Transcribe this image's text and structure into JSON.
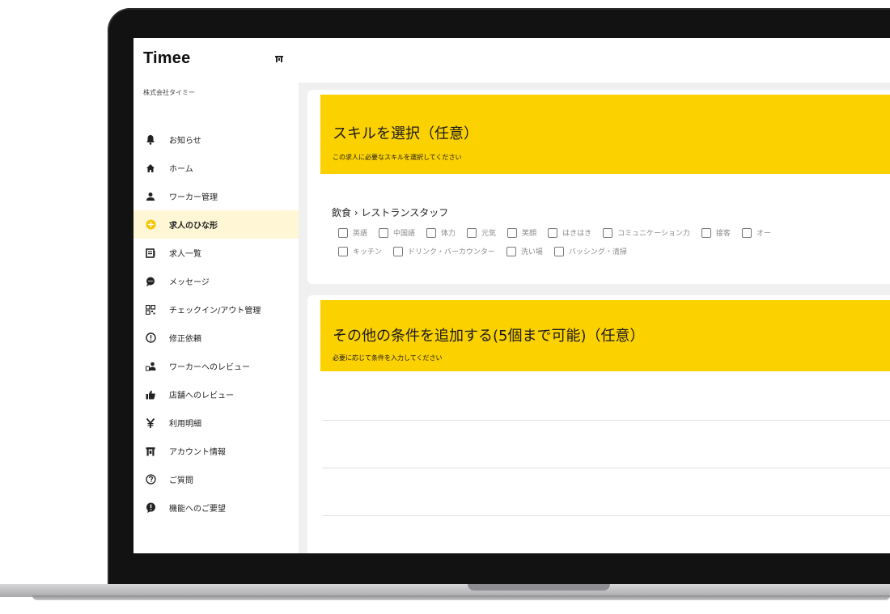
{
  "sidebar": {
    "brand": "Timee",
    "company": "株式会社タイミー",
    "items": [
      {
        "label": "お知らせ",
        "icon": "bell-icon"
      },
      {
        "label": "ホーム",
        "icon": "home-icon"
      },
      {
        "label": "ワーカー管理",
        "icon": "person-icon"
      },
      {
        "label": "求人のひな形",
        "icon": "plus-circle-icon",
        "active": true
      },
      {
        "label": "求人一覧",
        "icon": "list-icon"
      },
      {
        "label": "メッセージ",
        "icon": "chat-icon"
      },
      {
        "label": "チェックイン/アウト管理",
        "icon": "qr-code-icon"
      },
      {
        "label": "修正依頼",
        "icon": "alert-circle-icon"
      },
      {
        "label": "ワーカーへのレビュー",
        "icon": "worker-review-icon"
      },
      {
        "label": "店舗へのレビュー",
        "icon": "thumbs-up-icon"
      },
      {
        "label": "利用明細",
        "icon": "yen-icon"
      },
      {
        "label": "アカウント情報",
        "icon": "store-icon"
      },
      {
        "label": "ご質問",
        "icon": "help-icon"
      },
      {
        "label": "機能へのご要望",
        "icon": "exclamation-bubble-icon"
      }
    ]
  },
  "skills_section": {
    "title": "スキルを選択（任意）",
    "subtitle": "この求人に必要なスキルを選択してください",
    "category": "飲食 › レストランスタッフ",
    "skills_row1": [
      "英語",
      "中国語",
      "体力",
      "元気",
      "笑顔",
      "はきはき",
      "コミュニケーション力",
      "接客",
      "オー"
    ],
    "skills_row2": [
      "キッチン",
      "ドリンク・バーカウンター",
      "洗い場",
      "バッシング・清掃"
    ]
  },
  "conditions_section": {
    "title": "その他の条件を追加する(5個まで可能)（任意）",
    "subtitle": "必要に応じて条件を入力してください"
  },
  "colors": {
    "accent": "#fcd100",
    "active_bg": "#fff6d6",
    "active_icon": "#f5c400"
  }
}
